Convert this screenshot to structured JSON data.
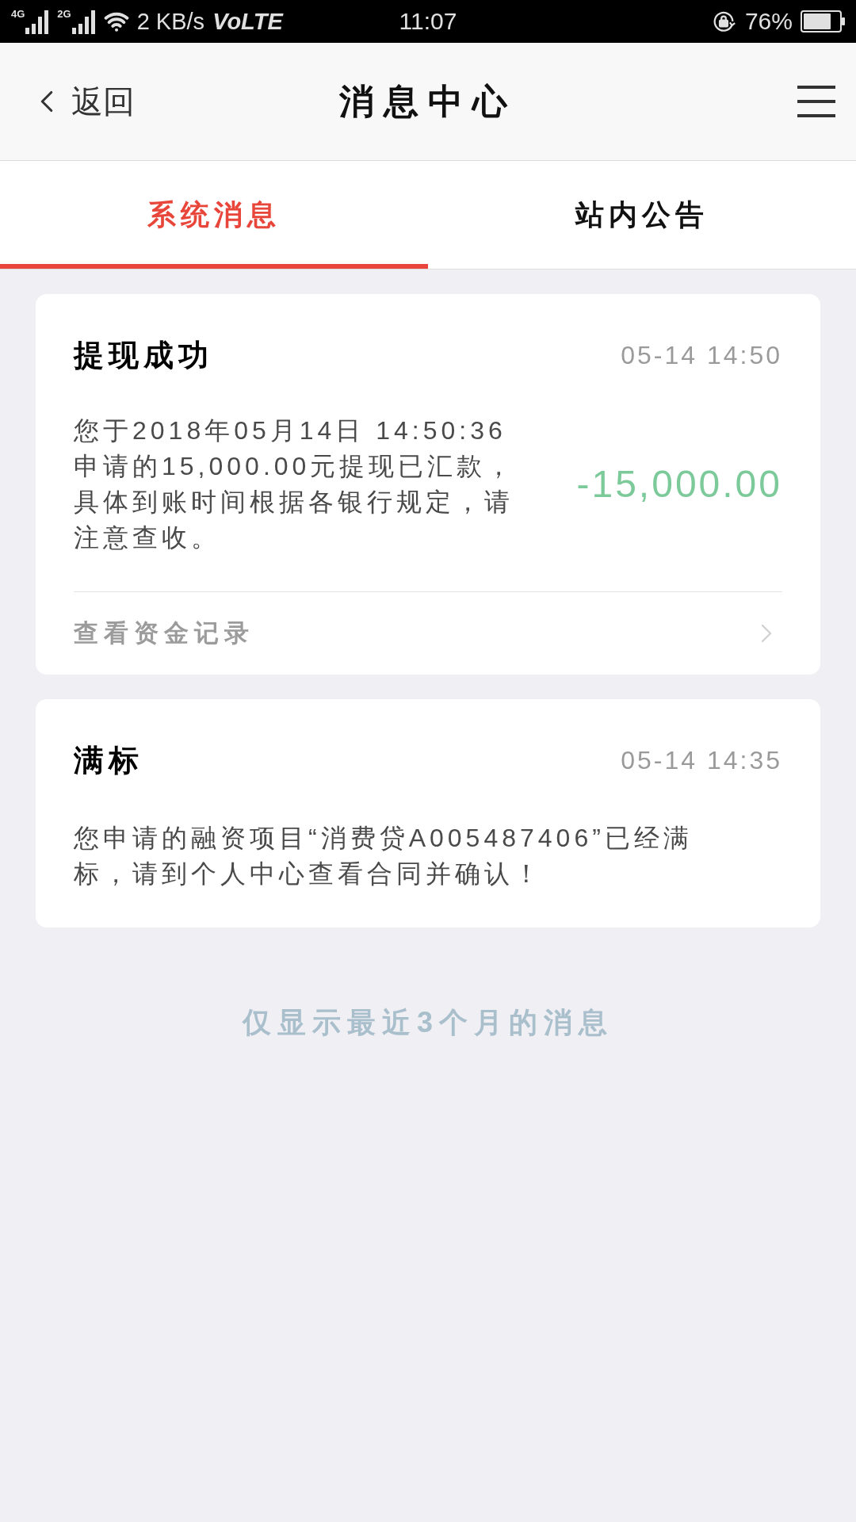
{
  "status_bar": {
    "signal_1_label": "4G",
    "signal_2_label": "2G",
    "speed": "2 KB/s",
    "volte": "VoLTE",
    "time": "11:07",
    "battery": "76%"
  },
  "header": {
    "back": "返回",
    "title": "消息中心"
  },
  "tabs": [
    {
      "label": "系统消息",
      "selected": true
    },
    {
      "label": "站内公告",
      "selected": false
    }
  ],
  "messages": [
    {
      "kind": "transaction",
      "title": "提现成功",
      "time": "05-14 14:50",
      "body": "您于2018年05月14日 14:50:36\n申请的15,000.00元提现已汇款，具体到账时间根据各银行规定，请注意查收。",
      "amount": "-15,000.00",
      "link": "查看资金记录"
    },
    {
      "kind": "notice",
      "title": "满标",
      "time": "05-14 14:35",
      "body": "您申请的融资项目“消费贷A005487406”已经满标，请到个人中心查看合同并确认！"
    }
  ],
  "footer_note": "仅显示最近3个月的消息"
}
